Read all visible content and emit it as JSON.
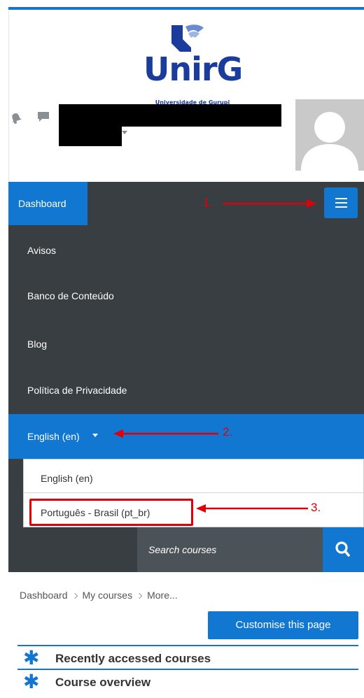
{
  "header": {
    "logo_text": "UnirG",
    "logo_subtitle": "Universidade de Gurupi"
  },
  "navbar": {
    "dashboard_label": "Dashboard",
    "menu_icon": "hamburger-menu-icon"
  },
  "menu": {
    "items": [
      {
        "label": "Avisos"
      },
      {
        "label": "Banco de Conteúdo"
      },
      {
        "label": "Blog"
      },
      {
        "label": "Política de Privacidade"
      }
    ],
    "language_selected": "English (en)",
    "language_options": [
      {
        "label": "English (en)"
      },
      {
        "label": "Português - Brasil (pt_br)"
      }
    ]
  },
  "search": {
    "placeholder": "Search courses",
    "icon": "search-icon"
  },
  "breadcrumb": {
    "items": [
      "Dashboard",
      "My courses",
      "More..."
    ]
  },
  "page": {
    "customise_label": "Customise this page",
    "blocks": [
      {
        "title": "Recently accessed courses"
      },
      {
        "title": "Course overview"
      }
    ]
  },
  "annotations": {
    "step1": "1.",
    "step2": "2.",
    "step3": "3."
  },
  "colors": {
    "primary": "#1177d1",
    "navbar": "#383e42",
    "annotation": "#e0000a"
  }
}
